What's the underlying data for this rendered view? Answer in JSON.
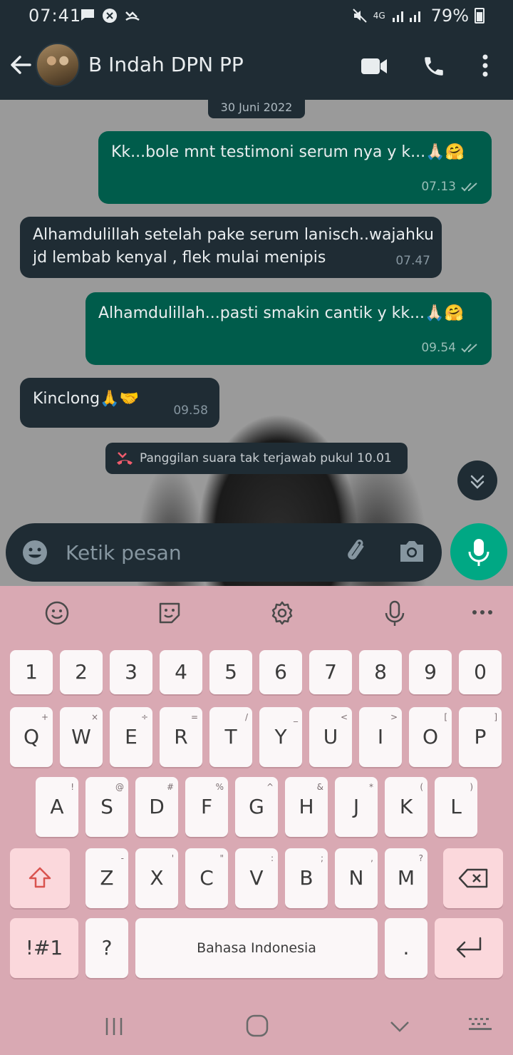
{
  "status_bar": {
    "time": "07:41",
    "battery": "79%",
    "network": "4G"
  },
  "header": {
    "contact_name": "B Indah DPN PP"
  },
  "chat": {
    "date_chip": "30 Juni 2022",
    "messages": [
      {
        "direction": "out",
        "text": "Kk...bole mnt testimoni serum nya y k...🙏🏻🤗",
        "time": "07.13"
      },
      {
        "direction": "in",
        "text_line1": "Alhamdulillah setelah pake serum lanisch..wajahku",
        "text_line2": "jd lembab kenyal , flek mulai menipis",
        "time": "07.47"
      },
      {
        "direction": "out",
        "text": "Alhamdulillah...pasti smakin cantik y kk...🙏🏻🤗",
        "time": "09.54"
      },
      {
        "direction": "in",
        "text": "Kinclong🙏🤝",
        "time": "09.58"
      }
    ],
    "missed_call": "Panggilan suara tak terjawab pukul 10.01"
  },
  "composer": {
    "placeholder": "Ketik pesan"
  },
  "keyboard": {
    "numbers": [
      "1",
      "2",
      "3",
      "4",
      "5",
      "6",
      "7",
      "8",
      "9",
      "0"
    ],
    "row_q": [
      [
        "Q",
        "+"
      ],
      [
        "W",
        "×"
      ],
      [
        "E",
        "÷"
      ],
      [
        "R",
        "="
      ],
      [
        "T",
        "/"
      ],
      [
        "Y",
        "_"
      ],
      [
        "U",
        "<"
      ],
      [
        "I",
        ">"
      ],
      [
        "O",
        "["
      ],
      [
        "P",
        "]"
      ]
    ],
    "row_a": [
      [
        "A",
        "!"
      ],
      [
        "S",
        "@"
      ],
      [
        "D",
        "#"
      ],
      [
        "F",
        "%"
      ],
      [
        "G",
        "^"
      ],
      [
        "H",
        "&"
      ],
      [
        "J",
        "*"
      ],
      [
        "K",
        "("
      ],
      [
        "L",
        ")"
      ]
    ],
    "row_z": [
      [
        "Z",
        "-"
      ],
      [
        "X",
        "'"
      ],
      [
        "C",
        "\""
      ],
      [
        "V",
        ":"
      ],
      [
        "B",
        ";"
      ],
      [
        "N",
        ","
      ],
      [
        "M",
        "?"
      ]
    ],
    "symbols_label": "!#1",
    "question_label": "?",
    "space_label": "Bahasa Indonesia",
    "period_label": "."
  },
  "colors": {
    "outgoing": "#005c4b",
    "incoming": "#1f2c34",
    "accent": "#00a884",
    "keyboard_bg": "#d9a9b3"
  },
  "icons": [
    "back-arrow-icon",
    "video-call-icon",
    "phone-icon",
    "more-vert-icon",
    "emoji-icon",
    "attach-icon",
    "camera-icon",
    "mic-icon",
    "double-check-icon",
    "missed-call-icon",
    "chevrons-down-icon"
  ]
}
